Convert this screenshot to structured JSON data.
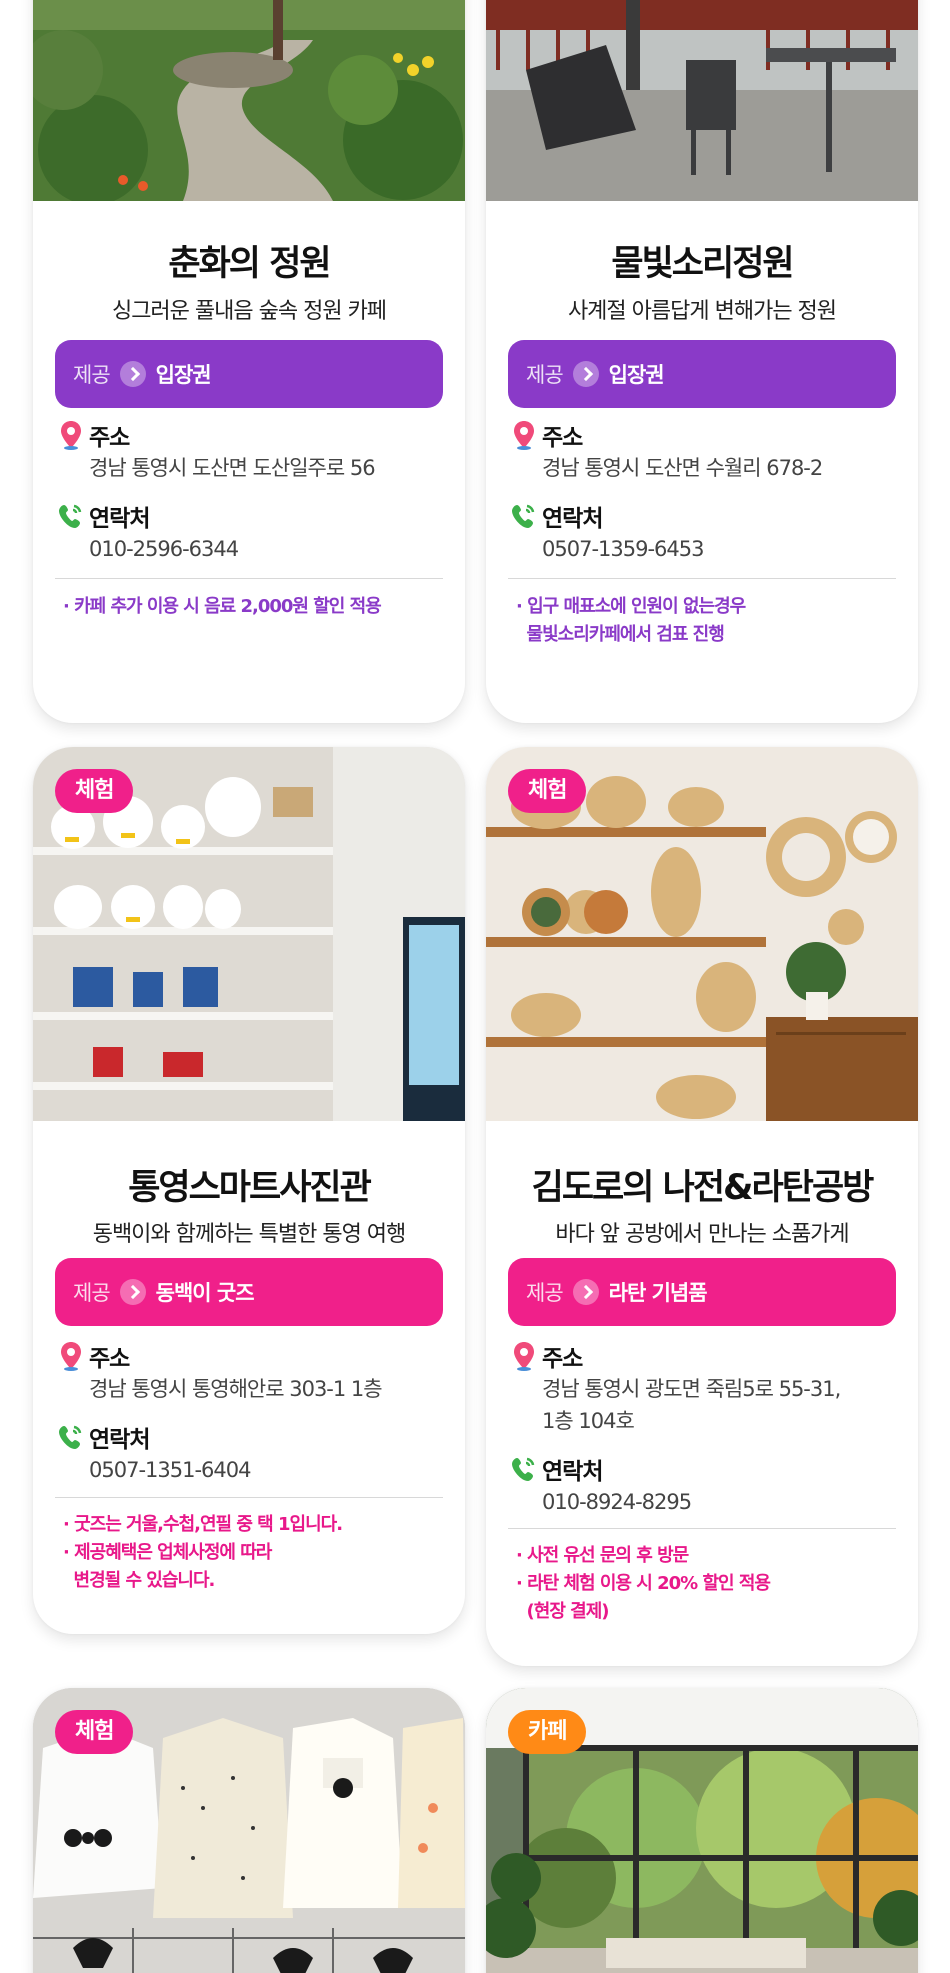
{
  "cards": [
    {
      "title": "춘화의 정원",
      "subtitle": "싱그러운 풀내음 숲속 정원 카페",
      "provide_label": "제공",
      "provide_value": "입장권",
      "address_label": "주소",
      "address": "경남 통영시 도산면 도산일주로 56",
      "contact_label": "연락처",
      "phone": "010-2596-6344",
      "notes": [
        "· 카페 추가 이용 시 음료 2,000원 할인 적용"
      ],
      "accent": "#8a3ac8",
      "image": "garden-path-photo"
    },
    {
      "title": "물빛소리정원",
      "subtitle": "사계절 아름답게 변해가는 정원",
      "provide_label": "제공",
      "provide_value": "입장권",
      "address_label": "주소",
      "address": "경남 통영시 도산면 수월리 678-2",
      "contact_label": "연락처",
      "phone": "0507-1359-6453",
      "notes": [
        "· 입구 매표소에 인원이 없는경우",
        "  물빛소리카페에서 검표 진행"
      ],
      "accent": "#8a3ac8",
      "image": "cafe-terrace-photo"
    },
    {
      "badge": "체험",
      "title": "통영스마트사진관",
      "subtitle": "동백이와 함께하는 특별한 통영 여행",
      "provide_label": "제공",
      "provide_value": "동백이 굿즈",
      "address_label": "주소",
      "address": "경남 통영시 통영해안로 303-1 1층",
      "contact_label": "연락처",
      "phone": "0507-1351-6404",
      "notes": [
        "· 굿즈는 거울,수첩,연필 중 택 1입니다.",
        "· 제공혜택은 업체사정에 따라",
        "  변경될 수 있습니다."
      ],
      "accent": "#f0208a",
      "image": "goods-shelf-photo"
    },
    {
      "badge": "체험",
      "title": "김도로의 나전&라탄공방",
      "subtitle": "바다 앞 공방에서 만나는 소품가게",
      "provide_label": "제공",
      "provide_value": "라탄 기념품",
      "address_label": "주소",
      "address_lines": [
        "경남 통영시 광도면 죽림5로 55-31,",
        "1층 104호"
      ],
      "contact_label": "연락처",
      "phone": "010-8924-8295",
      "notes": [
        "· 사전 유선 문의 후 방문",
        "· 라탄 체험 이용 시 20% 할인 적용",
        "  (현장 결제)"
      ],
      "accent": "#f0208a",
      "image": "rattan-shelf-photo"
    },
    {
      "badge": "체험",
      "image": "baby-dress-photo"
    },
    {
      "badge": "카페",
      "image": "glass-cafe-photo"
    }
  ],
  "icons": {
    "address": "map-pin-icon",
    "contact": "phone-icon",
    "arrow": "chevron-right-icon"
  },
  "colors": {
    "purple": "#8a3ac8",
    "pink": "#f0208a",
    "orange": "#ff8a16"
  }
}
